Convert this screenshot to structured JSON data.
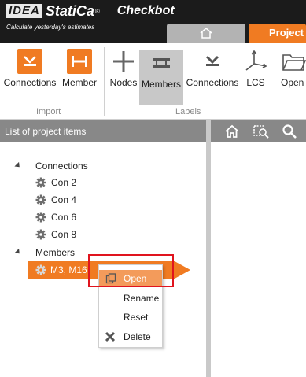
{
  "header": {
    "logo_idea": "IDEA",
    "logo_statica": "StatiCa",
    "logo_reg": "®",
    "app_name": "Checkbot",
    "tagline": "Calculate yesterday's estimates",
    "home_tab_icon": "home-icon",
    "project_tab": "Project"
  },
  "ribbon": {
    "import_group": "Import",
    "labels_group": "Labels",
    "buttons": [
      {
        "label": "Connections",
        "icon": "connection-import-icon"
      },
      {
        "label": "Member",
        "icon": "member-import-icon"
      },
      {
        "label": "Nodes",
        "icon": "nodes-icon"
      },
      {
        "label": "Members",
        "icon": "members-icon"
      },
      {
        "label": "Connections",
        "icon": "connections-icon"
      },
      {
        "label": "LCS",
        "icon": "lcs-icon"
      },
      {
        "label": "Open",
        "icon": "folder-icon"
      }
    ]
  },
  "panel": {
    "title": "List of project items",
    "toolbar_icons": [
      "home-icon",
      "zoom-icon",
      "search-icon"
    ]
  },
  "tree": {
    "connections_label": "Connections",
    "connections": [
      "Con 2",
      "Con 4",
      "Con 6",
      "Con 8"
    ],
    "members_label": "Members",
    "selected_member": "M3, M16"
  },
  "context_menu": {
    "items": [
      {
        "label": "Open",
        "icon": "open-icon"
      },
      {
        "label": "Rename",
        "icon": ""
      },
      {
        "label": "Reset",
        "icon": ""
      },
      {
        "label": "Delete",
        "icon": "delete-icon"
      }
    ]
  },
  "colors": {
    "accent": "#f07b22",
    "header_bg": "#1b1b1b",
    "panel_head": "#888888",
    "highlight_box": "#e0141e"
  }
}
